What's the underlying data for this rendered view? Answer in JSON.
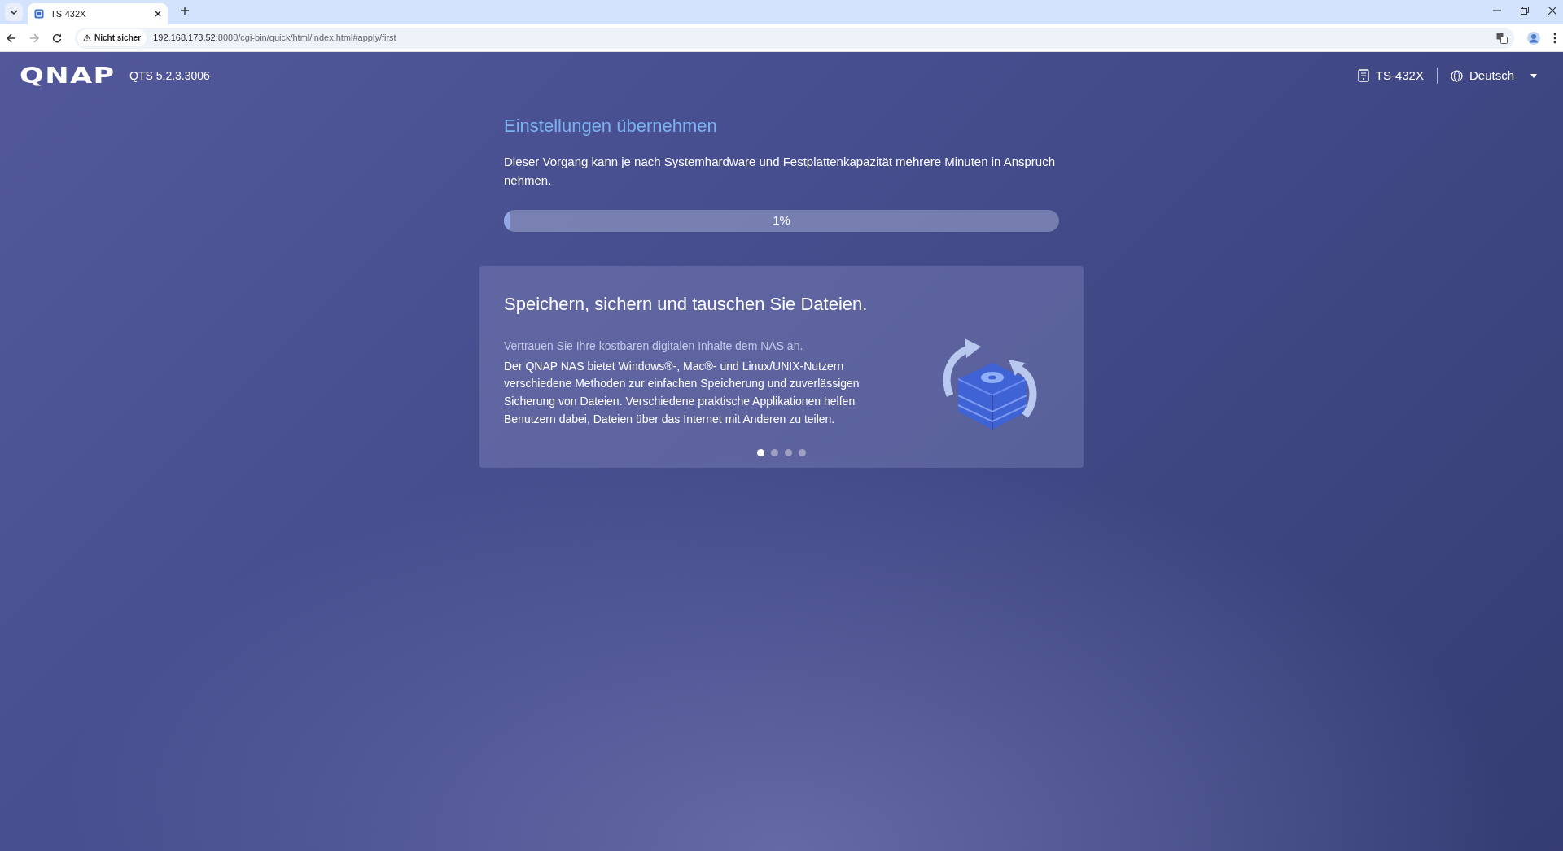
{
  "browser": {
    "tab": {
      "title": "TS-432X"
    },
    "address": {
      "security": "Nicht sicher",
      "host": "192.168.178.52",
      "path": ":8080/cgi-bin/quick/html/index.html#apply/first"
    }
  },
  "header": {
    "logo": "QNAP",
    "version": "QTS 5.2.3.3006",
    "device": "TS-432X",
    "language": "Deutsch"
  },
  "apply": {
    "title": "Einstellungen übernehmen",
    "description": "Dieser Vorgang kann je nach Systemhardware und Festplattenkapazität mehrere Minuten in Anspruch nehmen.",
    "progress": {
      "level": 0.01,
      "label": "1%"
    }
  },
  "carousel": {
    "title": "Speichern, sichern und tauschen Sie Dateien.",
    "lead": "Vertrauen Sie Ihre kostbaren digitalen Inhalte dem NAS an.",
    "body": "Der QNAP NAS bietet Windows®-, Mac®- und Linux/UNIX-Nutzern verschiedene Methoden zur einfachen Speicherung und zuverlässigen Sicherung von Dateien. Verschiedene praktische Applikationen helfen Benutzern dabei, Dateien über das Internet mit Anderen zu teilen.",
    "dots": [
      {
        "selected": true
      },
      {
        "selected": false
      },
      {
        "selected": false
      },
      {
        "selected": false
      }
    ]
  }
}
